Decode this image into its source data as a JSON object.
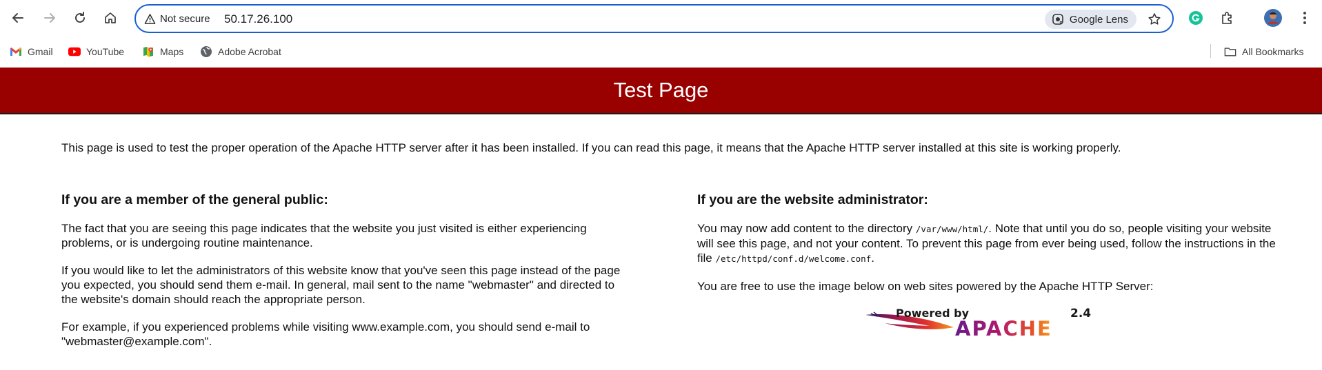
{
  "browser": {
    "security_label": "Not secure",
    "url": "50.17.26.100",
    "lens_label": "Google Lens",
    "all_bookmarks_label": "All Bookmarks",
    "bookmarks": [
      {
        "label": "Gmail",
        "icon": "gmail-icon"
      },
      {
        "label": "YouTube",
        "icon": "youtube-icon"
      },
      {
        "label": "Maps",
        "icon": "maps-icon"
      },
      {
        "label": "Adobe Acrobat",
        "icon": "globe-icon"
      }
    ]
  },
  "page": {
    "title": "Test Page",
    "intro": "This page is used to test the proper operation of the Apache HTTP server after it has been installed. If you can read this page, it means that the Apache HTTP server installed at this site is working properly.",
    "left": {
      "heading": "If you are a member of the general public:",
      "p1": "The fact that you are seeing this page indicates that the website you just visited is either experiencing problems, or is undergoing routine maintenance.",
      "p2": "If you would like to let the administrators of this website know that you've seen this page instead of the page you expected, you should send them e-mail. In general, mail sent to the name \"webmaster\" and directed to the website's domain should reach the appropriate person.",
      "p3": "For example, if you experienced problems while visiting www.example.com, you should send e-mail to \"webmaster@example.com\"."
    },
    "right": {
      "heading": "If you are the website administrator:",
      "p1_a": "You may now add content to the directory ",
      "p1_code1": "/var/www/html/",
      "p1_b": ". Note that until you do so, people visiting your website will see this page, and not your content. To prevent this page from ever being used, follow the instructions in the file ",
      "p1_code2": "/etc/httpd/conf.d/welcome.conf",
      "p1_c": ".",
      "p2": "You are free to use the image below on web sites powered by the Apache HTTP Server:"
    },
    "logo": {
      "powered_by": "Powered by",
      "name": "APACHE",
      "version": "2.4"
    },
    "colors": {
      "banner": "#990000",
      "omnibox_border": "#1a5fd1"
    }
  }
}
